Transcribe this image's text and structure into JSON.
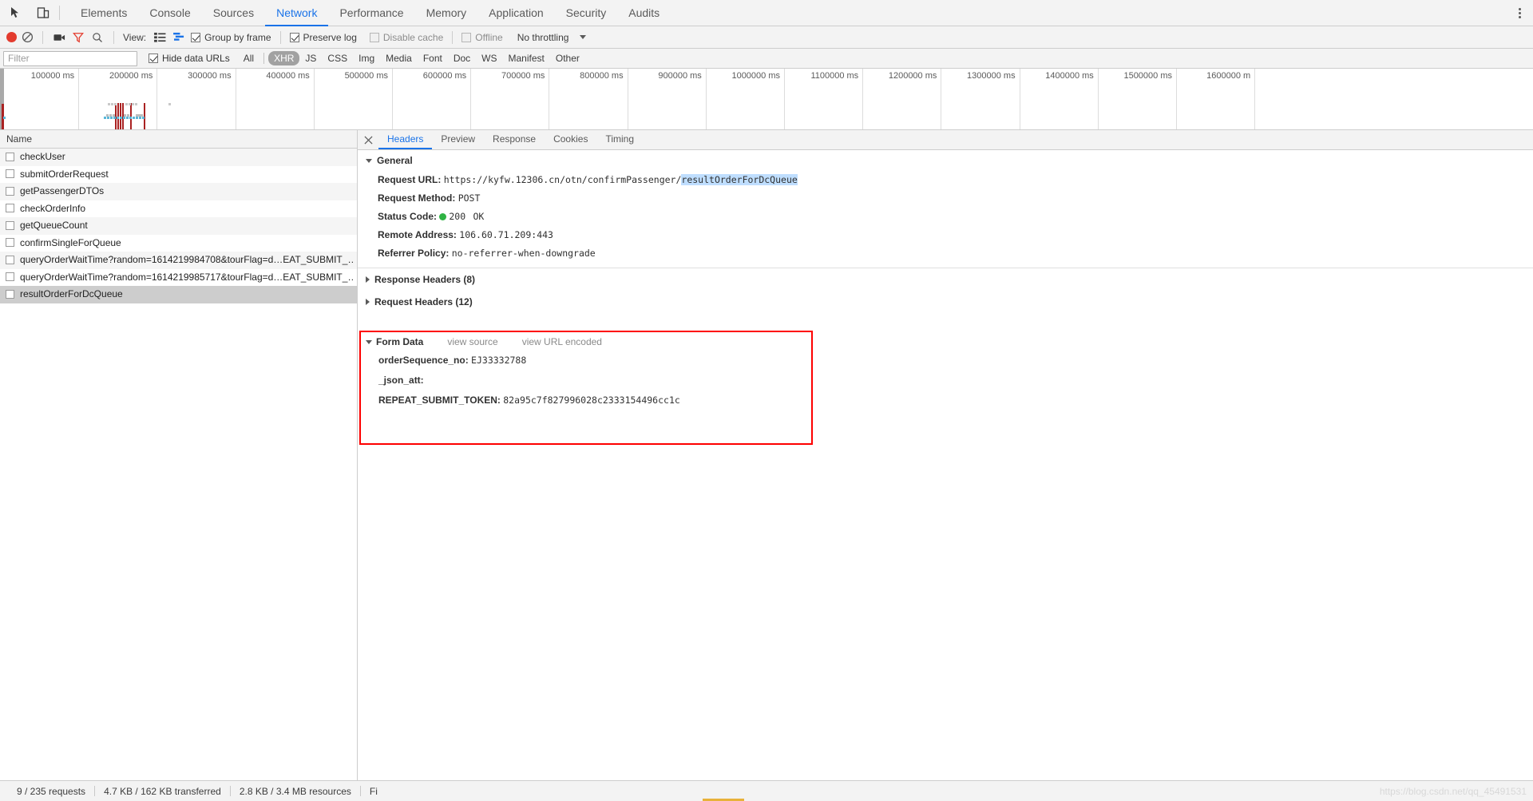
{
  "topbar": {
    "icons": [
      "inspect-element-icon",
      "device-toolbar-icon"
    ],
    "tabs": [
      {
        "label": "Elements",
        "active": false
      },
      {
        "label": "Console",
        "active": false
      },
      {
        "label": "Sources",
        "active": false
      },
      {
        "label": "Network",
        "active": true
      },
      {
        "label": "Performance",
        "active": false
      },
      {
        "label": "Memory",
        "active": false
      },
      {
        "label": "Application",
        "active": false
      },
      {
        "label": "Security",
        "active": false
      },
      {
        "label": "Audits",
        "active": false
      }
    ],
    "more_label": "more-options"
  },
  "toolbar": {
    "record_title": "Stop recording network log",
    "clear_title": "Clear",
    "camera_title": "Capture screenshots",
    "filter_title": "Filter",
    "search_title": "Search",
    "view_label": "View:",
    "group_by_frame": {
      "label": "Group by frame",
      "checked": true
    },
    "preserve_log": {
      "label": "Preserve log",
      "checked": true
    },
    "disable_cache": {
      "label": "Disable cache",
      "checked": false
    },
    "offline": {
      "label": "Offline",
      "checked": false
    },
    "throttling": "No throttling"
  },
  "filterbar": {
    "filter_placeholder": "Filter",
    "filter_value": "",
    "hide_data_urls": {
      "label": "Hide data URLs",
      "checked": true
    },
    "types": [
      {
        "label": "All",
        "selected": false
      },
      {
        "label": "XHR",
        "selected": true
      },
      {
        "label": "JS",
        "selected": false
      },
      {
        "label": "CSS",
        "selected": false
      },
      {
        "label": "Img",
        "selected": false
      },
      {
        "label": "Media",
        "selected": false
      },
      {
        "label": "Font",
        "selected": false
      },
      {
        "label": "Doc",
        "selected": false
      },
      {
        "label": "WS",
        "selected": false
      },
      {
        "label": "Manifest",
        "selected": false
      },
      {
        "label": "Other",
        "selected": false
      }
    ]
  },
  "overview": {
    "ticks": [
      "100000 ms",
      "200000 ms",
      "300000 ms",
      "400000 ms",
      "500000 ms",
      "600000 ms",
      "700000 ms",
      "800000 ms",
      "900000 ms",
      "1000000 ms",
      "1100000 ms",
      "1200000 ms",
      "1300000 ms",
      "1400000 ms",
      "1500000 ms",
      "1600000 m"
    ]
  },
  "requests": {
    "column_header": "Name",
    "rows": [
      {
        "name": "checkUser",
        "selected": false
      },
      {
        "name": "submitOrderRequest",
        "selected": false
      },
      {
        "name": "getPassengerDTOs",
        "selected": false
      },
      {
        "name": "checkOrderInfo",
        "selected": false
      },
      {
        "name": "getQueueCount",
        "selected": false
      },
      {
        "name": "confirmSingleForQueue",
        "selected": false
      },
      {
        "name": "queryOrderWaitTime?random=1614219984708&tourFlag=d…EAT_SUBMIT_…",
        "selected": false
      },
      {
        "name": "queryOrderWaitTime?random=1614219985717&tourFlag=d…EAT_SUBMIT_…",
        "selected": false
      },
      {
        "name": "resultOrderForDcQueue",
        "selected": true
      }
    ]
  },
  "details": {
    "close_label": "×",
    "tabs": [
      {
        "label": "Headers",
        "active": true
      },
      {
        "label": "Preview",
        "active": false
      },
      {
        "label": "Response",
        "active": false
      },
      {
        "label": "Cookies",
        "active": false
      },
      {
        "label": "Timing",
        "active": false
      }
    ],
    "general": {
      "title": "General",
      "request_url_label": "Request URL:",
      "request_url_prefix": "https://kyfw.12306.cn/otn/confirmPassenger/",
      "request_url_highlight": "resultOrderForDcQueue",
      "request_method_label": "Request Method:",
      "request_method": "POST",
      "status_code_label": "Status Code:",
      "status_code": "200",
      "status_text": "OK",
      "remote_address_label": "Remote Address:",
      "remote_address": "106.60.71.209:443",
      "referrer_policy_label": "Referrer Policy:",
      "referrer_policy": "no-referrer-when-downgrade"
    },
    "response_headers": "Response Headers (8)",
    "request_headers": "Request Headers (12)",
    "form_data": {
      "title": "Form Data",
      "view_source": "view source",
      "view_url_encoded": "view URL encoded",
      "rows": [
        {
          "key": "orderSequence_no:",
          "value": "EJ33332788"
        },
        {
          "key": "_json_att:",
          "value": ""
        },
        {
          "key": "REPEAT_SUBMIT_TOKEN:",
          "value": "82a95c7f827996028c2333154496cc1c"
        }
      ]
    }
  },
  "statusbar": {
    "requests": "9 / 235 requests",
    "transferred": "4.7 KB / 162 KB transferred",
    "resources": "2.8 KB / 3.4 MB resources",
    "finish_truncated": "Fi"
  },
  "watermark": "https://blog.csdn.net/qq_45491531",
  "colors": {
    "accent": "#1a73e8",
    "record": "#e33b2e",
    "highlight_box": "#fe0000",
    "selection": "#bfdeff",
    "status_ok": "#2fb344"
  }
}
